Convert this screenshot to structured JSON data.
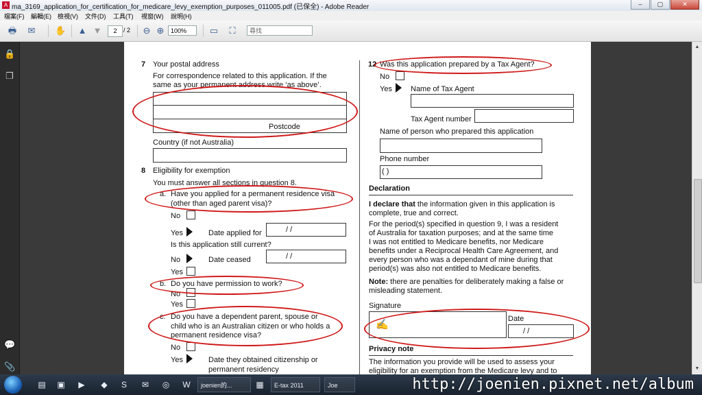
{
  "window": {
    "title": "ma_3169_application_for_certification_for_medicare_levy_exemption_purposes_011005.pdf (已保全) - Adobe Reader",
    "minimize": "–",
    "maximize": "▢",
    "close": "✕"
  },
  "menu": [
    "檔案(F)",
    "編輯(E)",
    "檢視(V)",
    "文件(D)",
    "工具(T)",
    "視窗(W)",
    "說明(H)"
  ],
  "toolbar": {
    "page_current": "2",
    "page_total": "/ 2",
    "zoom": "100%",
    "search_placeholder": "尋找"
  },
  "form": {
    "q7": {
      "num": "7",
      "title": "Your postal address",
      "desc1": "For correspondence related to this application. If the",
      "desc2": "same as your permanent address write ‘as above’.",
      "postcode": "Postcode",
      "country": "Country (if not Australia)"
    },
    "q8": {
      "num": "8",
      "title": "Eligibility for exemption",
      "intro": "You must answer all sections in question 8.",
      "a_label": "a.",
      "a_line1": "Have you applied for a permanent residence visa",
      "a_line2": "(other than aged parent visa)?",
      "no": "No",
      "yes": "Yes",
      "date_applied": "Date applied for",
      "date_slashes": "/       /",
      "still_current": "Is this application still current?",
      "date_ceased": "Date ceased",
      "b_label": "b.",
      "b_text": "Do you have permission to work?",
      "c_label": "c.",
      "c_line1": "Do you have a dependent parent, spouse or",
      "c_line2": "child who is an Australian citizen or who holds a",
      "c_line3": "permanent residence visa?",
      "obtained1": "Date they obtained citizenship or",
      "obtained2": "permanent residency"
    },
    "q12": {
      "num": "12",
      "title": "Was this application prepared by a Tax Agent?",
      "no": "No",
      "yes": "Yes",
      "agent_name": "Name of Tax Agent",
      "agent_number": "Tax Agent number",
      "preparer": "Name of person who prepared this application",
      "phone": "Phone number",
      "phone_parens": "(       )"
    },
    "declaration": {
      "heading": "Declaration",
      "lead_bold": "I declare that",
      "line1_rest": "the information given in this application is",
      "line2": "complete, true and correct.",
      "line3": "For the period(s) specified in question 9, I was a resident",
      "line4": "of Australia for taxation purposes; and at the same time",
      "line5": "I was not entitled to Medicare benefits, nor Medicare",
      "line6": "benefits under a Reciprocal Health Care Agreement, and",
      "line7": "every person who was a dependant of mine during that",
      "line8": "period(s) was also not entitled to Medicare benefits.",
      "note_bold": "Note:",
      "note_rest": "there are penalties for deliberately making a false or",
      "note_line2": "misleading statement.",
      "signature": "Signature",
      "date": "Date",
      "date_slashes": "/      /"
    },
    "privacy": {
      "heading": "Privacy note",
      "line1": "The information you provide will be used to assess your",
      "line2": "eligibility for an exemption from the Medicare levy and to"
    }
  },
  "taskbar": {
    "items": [
      "joenien的...",
      "E-tax 2011",
      "Joe"
    ]
  },
  "watermark": "http://joenien.pixnet.net/album",
  "colors": {
    "annotation": "#d01818",
    "titlebar": "#dfe6ef"
  }
}
